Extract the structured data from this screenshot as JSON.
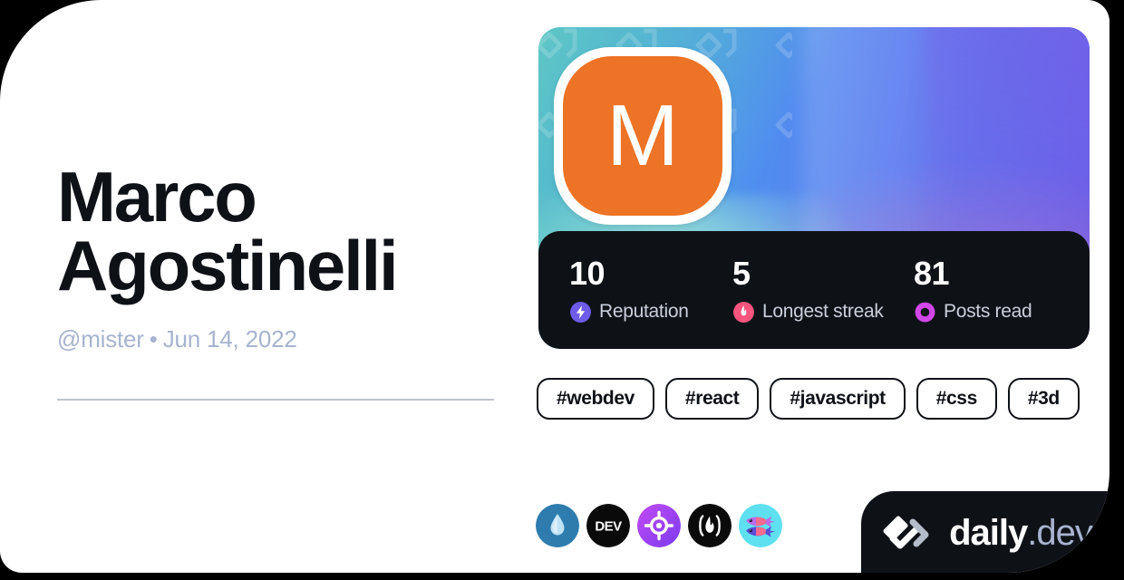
{
  "card": {
    "profile": {
      "display_name": "Marco Agostinelli",
      "handle": "@mister",
      "separator": "•",
      "join_date": "Jun 14, 2022",
      "avatar_initial": "M",
      "avatar_color": "#ED7326"
    },
    "stats": [
      {
        "value": "10",
        "label": "Reputation",
        "icon": "reputation-bolt-icon",
        "color": "#6E5BE8"
      },
      {
        "value": "5",
        "label": "Longest streak",
        "icon": "streak-flame-icon",
        "color": "#F8557E"
      },
      {
        "value": "81",
        "label": "Posts read",
        "icon": "posts-read-ring-icon",
        "color": "#D247E8"
      }
    ],
    "tags": [
      {
        "label": "#webdev"
      },
      {
        "label": "#react"
      },
      {
        "label": "#javascript"
      },
      {
        "label": "#css"
      },
      {
        "label": "#3d"
      }
    ],
    "sources": [
      {
        "name": "water-droplet-source-icon",
        "bg": "#2E7CAD"
      },
      {
        "name": "dev-to-source-icon",
        "bg": "#0A0A0A",
        "text": "DEV"
      },
      {
        "name": "crosshair-target-source-icon",
        "bg": "#A23BF0"
      },
      {
        "name": "hashnode-flame-source-icon",
        "bg": "#0A0A0A"
      },
      {
        "name": "two-fish-source-icon",
        "bg": "#5FE0F0"
      }
    ],
    "badge": {
      "logo_icon": "daily-dev-chevron-logo",
      "brand": "daily",
      "suffix": ".dev"
    },
    "theme": {
      "card_bg": "#FFFFFF",
      "text_primary": "#0E1217",
      "text_muted": "#A8B3CF",
      "stats_bar_bg": "#0E1217",
      "divider": "#C0C4CB"
    }
  }
}
